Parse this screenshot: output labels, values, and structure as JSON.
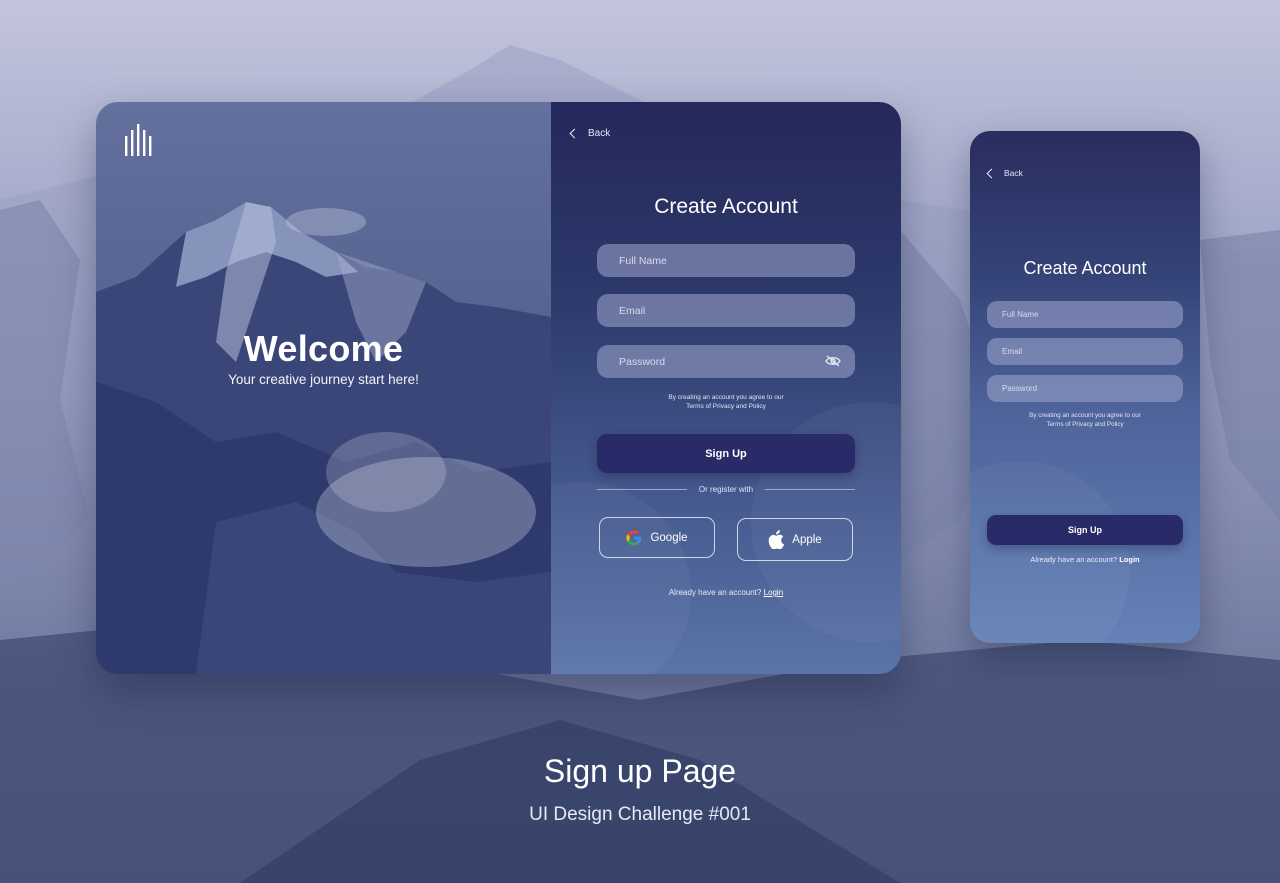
{
  "desktop": {
    "hero": {
      "logo_icon": "building-bars-icon",
      "title": "Welcome",
      "subtitle": "Your creative journey start here!"
    },
    "form": {
      "back_label": "Back",
      "title": "Create Account",
      "full_name_placeholder": "Full Name",
      "email_placeholder": "Email",
      "password_placeholder": "Password",
      "password_toggle_icon": "eye-off-icon",
      "terms_line1": "By creating an account you agree to our",
      "terms_line2": "Terms of Privacy and Policy",
      "signup_label": "Sign Up",
      "divider_label": "Or register with",
      "google_label": "Google",
      "apple_label": "Apple",
      "login_prompt": "Already have an account?",
      "login_link": "Login"
    }
  },
  "mobile": {
    "back_label": "Back",
    "title": "Create Account",
    "full_name_placeholder": "Full Name",
    "email_placeholder": "Email",
    "password_placeholder": "Password",
    "terms_line1": "By creating an account you agree to our",
    "terms_line2": "Terms of Privacy and Policy",
    "signup_label": "Sign Up",
    "login_prompt": "Already have an account?",
    "login_link": "Login"
  },
  "caption": {
    "title": "Sign up Page",
    "subtitle": "UI Design Challenge #001"
  },
  "colors": {
    "primary_button": "#282b67",
    "panel_top": "#25285a",
    "input_fill": "#a0a8cd"
  }
}
